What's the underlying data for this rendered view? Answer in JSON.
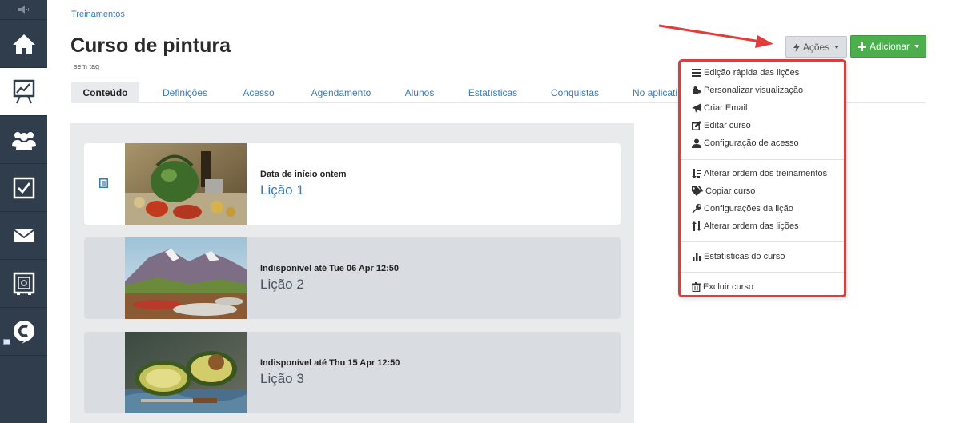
{
  "breadcrumb": {
    "label": "Treinamentos"
  },
  "course": {
    "title": "Curso de pintura",
    "tag": "sem tag"
  },
  "tabs": [
    {
      "label": "Conteúdo",
      "active": true
    },
    {
      "label": "Definições"
    },
    {
      "label": "Acesso"
    },
    {
      "label": "Agendamento"
    },
    {
      "label": "Alunos"
    },
    {
      "label": "Estatísticas"
    },
    {
      "label": "Conquistas"
    },
    {
      "label": "No aplicati"
    }
  ],
  "toolbar": {
    "actions_label": "Ações",
    "add_label": "Adicionar"
  },
  "actions_menu": {
    "items": [
      {
        "label": "Edição rápida das lições",
        "icon": "list-icon"
      },
      {
        "label": "Personalizar visualização",
        "icon": "puzzle-icon"
      },
      {
        "label": "Criar Email",
        "icon": "send-icon"
      },
      {
        "label": "Editar curso",
        "icon": "edit-icon"
      },
      {
        "label": "Configuração de acesso",
        "icon": "user-icon"
      },
      {
        "label": "Alterar ordem dos treinamentos",
        "icon": "sort-icon"
      },
      {
        "label": "Copiar curso",
        "icon": "tags-icon"
      },
      {
        "label": "Configurações da lição",
        "icon": "wrench-icon"
      },
      {
        "label": "Alterar ordem das lições",
        "icon": "reorder-icon"
      },
      {
        "label": "Estatísticas do curso",
        "icon": "bar-chart-icon"
      },
      {
        "label": "Excluir curso",
        "icon": "trash-icon"
      }
    ]
  },
  "lessons": [
    {
      "status": "Data de início ontem",
      "name": "Lição 1",
      "available": true
    },
    {
      "status": "Indisponível até Tue 06 Apr 12:50",
      "name": "Lição 2",
      "available": false
    },
    {
      "status": "Indisponível até Thu 15 Apr 12:50",
      "name": "Lição 3",
      "available": false
    }
  ],
  "sidebar": {
    "items": [
      {
        "icon": "home-icon"
      },
      {
        "icon": "presentation-chart-icon",
        "active": true
      },
      {
        "icon": "users-icon"
      },
      {
        "icon": "checkbox-icon"
      },
      {
        "icon": "mail-icon"
      },
      {
        "icon": "safe-icon"
      },
      {
        "icon": "chat-logo-icon"
      }
    ]
  },
  "colors": {
    "sidebar": "#2f3d4d",
    "link": "#3a7ab8",
    "add_button": "#4cae4c",
    "highlight_border": "#e23b3b"
  }
}
